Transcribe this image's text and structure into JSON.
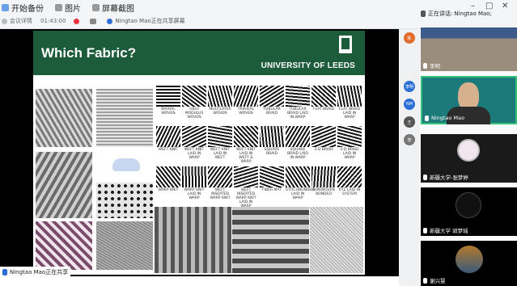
{
  "toolbar": {
    "start_backup": "开始备份",
    "tab_clip": "图片",
    "tab_screenshot": "屏幕截图",
    "meeting_details": "会议详情",
    "timer": "01:43:00",
    "notice_text": "Ningtao Mao正在共享屏幕",
    "icon_names": [
      "refresh-icon",
      "image-icon",
      "screenshot-icon",
      "record-icon"
    ]
  },
  "speaking": {
    "prefix": "正在讲话:",
    "name": "Ningtao Mao;"
  },
  "slide": {
    "title": "Which Fabric?",
    "university": "UNIVERSITY OF LEEDS",
    "header_color": "#1d5c3a",
    "structures": [
      "BIAXIAL WOVEN",
      "HIGH MODULUS WOVEN",
      "MULTILAYER WOVEN",
      "TRIAXIAL WOVEN",
      "TUBULAR BRAID",
      "TUBULAR BRAID LAID IN WARP",
      "FLAT BRAID",
      "FLAT BRAID LAID IN WARP",
      "WEFT KNIT",
      "WEFT KNIT LAID IN WARP",
      "WEFT KNIT LAID IN WEFT",
      "WEFT KNIT LAID IN WEFT & WARP",
      "SQUARE BRAID",
      "SQUARE BRAID LAID IN WARP",
      "3-D BRAID",
      "3-D BRAID LAID IN WARP",
      "WARP KNIT",
      "WARP KNIT LAID IN WARP",
      "WEFT INSERTED WARP KNIT",
      "WEFT INSERTED WARP KNIT LAID IN WARP",
      "FIBER MAT",
      "STITCHBONDED LAID IN WARP",
      "NONWOVEN BONDED",
      "XYZ LAID IN SYSTEM"
    ]
  },
  "participants": {
    "video_me": "Ningtao Mao",
    "video_2": "新疆大学-张梦婷",
    "video_3": "新疆大学 郭梦瑶",
    "video_4": "谢兴慧",
    "room_name": "李明",
    "side_avatars": [
      "陈",
      "李明",
      "NM",
      "王",
      "李"
    ]
  },
  "status": {
    "sharing": "Ningtao Mao正在共享"
  },
  "colors": {
    "accent_green": "#35c17b",
    "mic_blue": "#2b6fd6"
  }
}
